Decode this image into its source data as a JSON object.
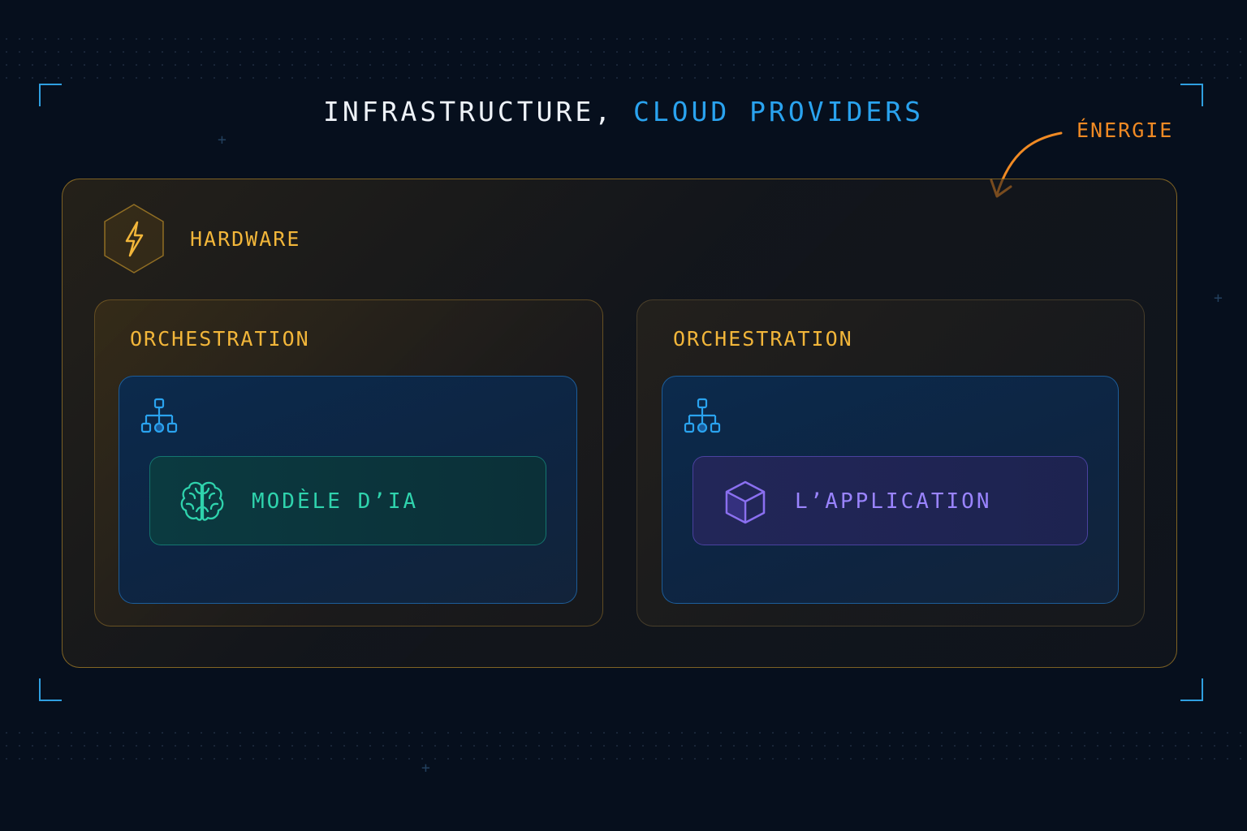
{
  "title": {
    "part1": "INFRASTRUCTURE, ",
    "part2": "CLOUD PROVIDERS"
  },
  "energy_label": "ÉNERGIE",
  "hardware": {
    "label": "HARDWARE",
    "icon": "lightning-bolt-icon"
  },
  "orchestration": [
    {
      "label": "ORCHESTRATION",
      "icon": "hierarchy-tree-icon",
      "component": {
        "label": "MODÈLE D’IA",
        "icon": "brain-icon"
      }
    },
    {
      "label": "ORCHESTRATION",
      "icon": "hierarchy-tree-icon",
      "component": {
        "label": "L’APPLICATION",
        "icon": "cube-icon"
      }
    }
  ],
  "colors": {
    "background": "#060f1d",
    "title": "#eef2f8",
    "accent_blue": "#2aa3ef",
    "energy_orange": "#f08a24",
    "hardware_gold": "#f2b63a",
    "model_teal": "#2fd3ad",
    "app_purple": "#9a84ff"
  }
}
